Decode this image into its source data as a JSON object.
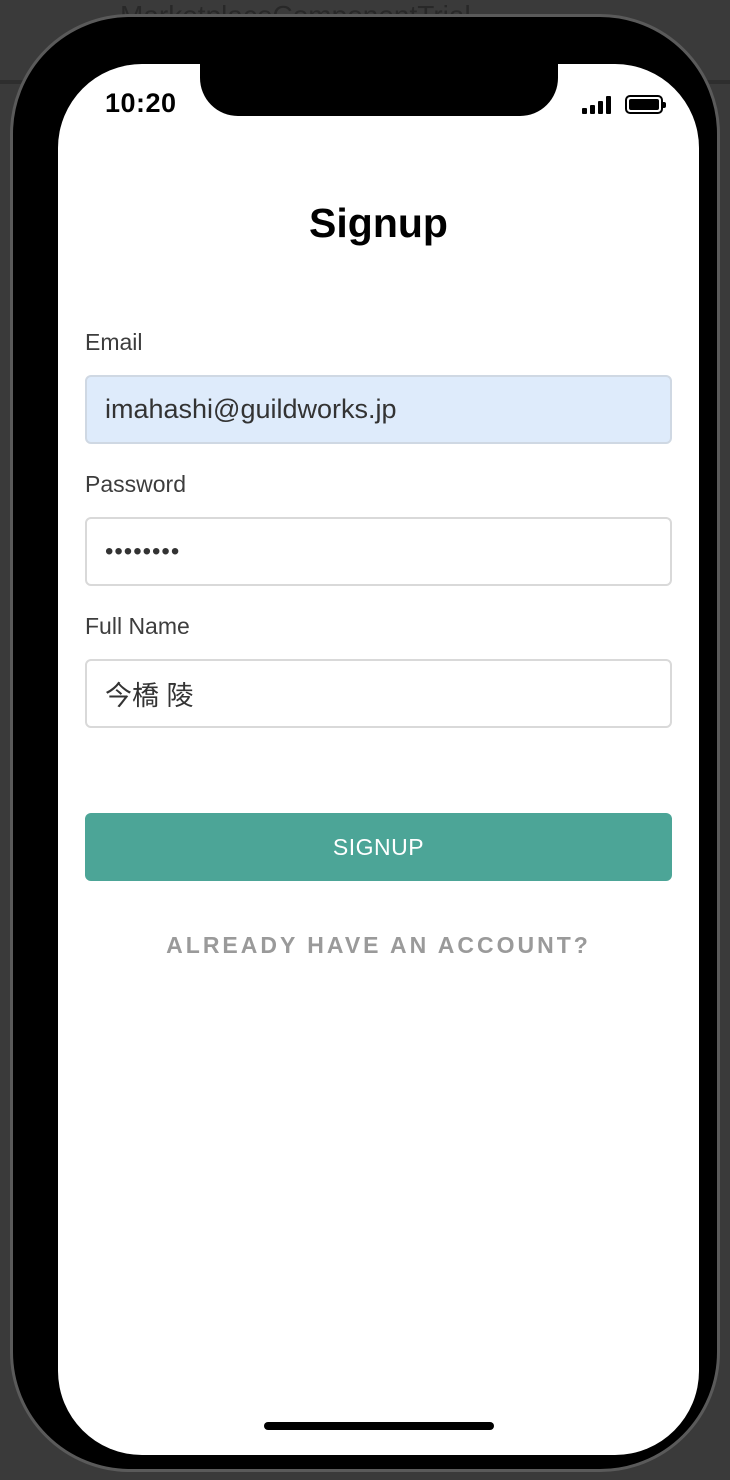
{
  "backdrop": {
    "title": "MarketplaceComponentTrial"
  },
  "status_bar": {
    "time": "10:20",
    "signal_icon": "cellular-signal-icon",
    "battery_icon": "battery-full-icon"
  },
  "page": {
    "title": "Signup"
  },
  "form": {
    "email": {
      "label": "Email",
      "value": "imahashi@guildworks.jp"
    },
    "password": {
      "label": "Password",
      "value": "••••••••"
    },
    "full_name": {
      "label": "Full Name",
      "value": "今橋 陵"
    },
    "submit_label": "SIGNUP",
    "submit_color": "#4ca597",
    "alt_link_label": "ALREADY HAVE AN ACCOUNT?"
  }
}
